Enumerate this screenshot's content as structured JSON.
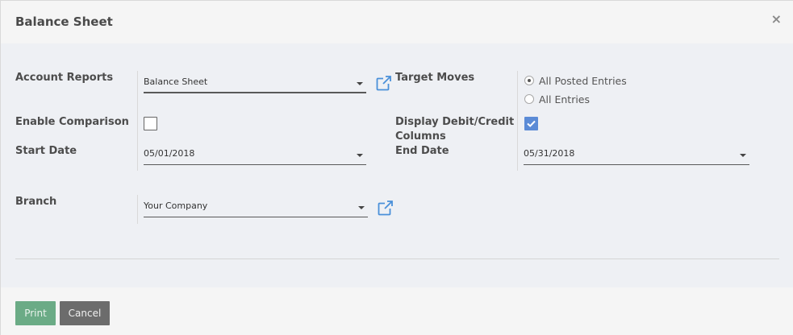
{
  "dialog": {
    "title": "Balance Sheet",
    "close_glyph": "×"
  },
  "form": {
    "account_reports": {
      "label": "Account Reports",
      "value": "Balance Sheet"
    },
    "target_moves": {
      "label": "Target Moves",
      "options": [
        {
          "label": "All Posted Entries",
          "checked": true
        },
        {
          "label": "All Entries",
          "checked": false
        }
      ]
    },
    "enable_comparison": {
      "label": "Enable Comparison",
      "checked": false
    },
    "display_debit_credit": {
      "label_line1": "Display Debit/Credit",
      "label_line2": "Columns",
      "checked": true
    },
    "start_date": {
      "label": "Start Date",
      "value": "05/01/2018"
    },
    "end_date": {
      "label": "End Date",
      "value": "05/31/2018"
    },
    "branch": {
      "label": "Branch",
      "value": "Your Company"
    }
  },
  "footer": {
    "print_label": "Print",
    "cancel_label": "Cancel"
  },
  "colors": {
    "accent_checkbox": "#5b8bd6",
    "print_button": "#6bab86",
    "cancel_button": "#6c6c6c",
    "external_link_icon": "#4a90d9"
  }
}
